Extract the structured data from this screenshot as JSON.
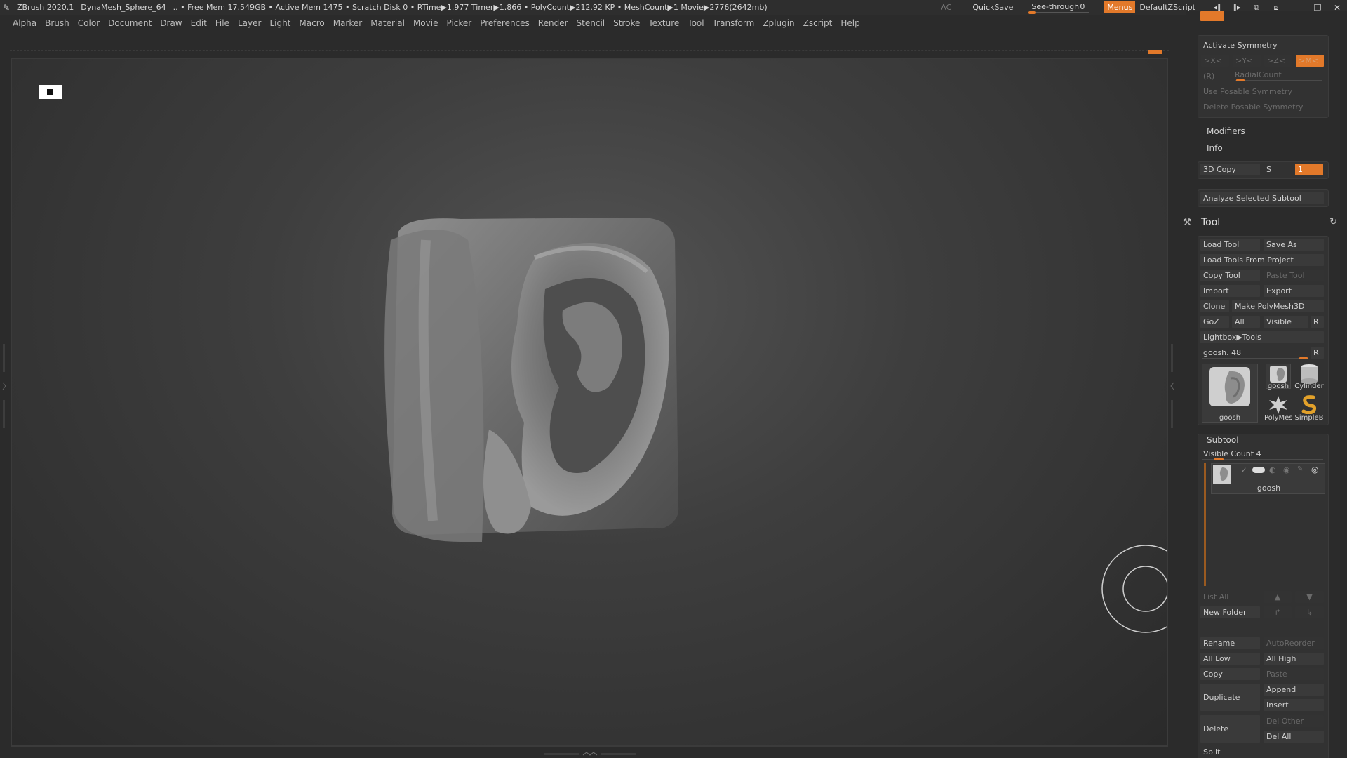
{
  "titlebar": {
    "app": "ZBrush 2020.1",
    "document": "DynaMesh_Sphere_64",
    "stats": ".. • Free Mem 17.549GB • Active Mem 1475 • Scratch Disk 0 • RTime▶1.977 Timer▶1.866 • PolyCount▶212.92 KP • MeshCount▶1 Movie▶2776(2642mb)",
    "ac": "AC",
    "quicksave": "QuickSave",
    "see_through_label": "See-through",
    "see_through_value": "0",
    "see_through_level": 0,
    "menus": "Menus",
    "default_zscript": "DefaultZScript"
  },
  "menubar": [
    "Alpha",
    "Brush",
    "Color",
    "Document",
    "Draw",
    "Edit",
    "File",
    "Layer",
    "Light",
    "Macro",
    "Marker",
    "Material",
    "Movie",
    "Picker",
    "Preferences",
    "Render",
    "Stencil",
    "Stroke",
    "Texture",
    "Tool",
    "Transform",
    "Zplugin",
    "Zscript",
    "Help"
  ],
  "symmetry": {
    "activate": "Activate Symmetry",
    "x": ">X<",
    "y": ">Y<",
    "z": ">Z<",
    "m": ">M<",
    "r": "(R)",
    "radial_count": "RadialCount",
    "use_posable": "Use Posable Symmetry",
    "delete_posable": "Delete Posable Symmetry"
  },
  "modifiers": "Modifiers",
  "info": "Info",
  "copy3d": {
    "label": "3D Copy",
    "s": "S",
    "value": "1"
  },
  "analyze": "Analyze Selected Subtool",
  "tool": {
    "title": "Tool",
    "load_tool": "Load Tool",
    "save_as": "Save As",
    "load_from_project": "Load Tools From Project",
    "copy_tool": "Copy Tool",
    "paste_tool": "Paste Tool",
    "import": "Import",
    "export": "Export",
    "clone": "Clone",
    "make_polymesh": "Make PolyMesh3D",
    "goz": "GoZ",
    "all": "All",
    "visible": "Visible",
    "r": "R",
    "lightbox": "Lightbox▶Tools",
    "current_name": "goosh. 48",
    "current_r": "R",
    "thumbs": {
      "main": "goosh",
      "small1": "goosh",
      "cylinder": "Cylinder",
      "polymesh": "PolyMes",
      "simpleb": "SimpleB"
    }
  },
  "subtool": {
    "title": "Subtool",
    "visible_count": "Visible Count 4",
    "item_name": "goosh",
    "list_all": "List All",
    "new_folder": "New Folder",
    "rename": "Rename",
    "auto_reorder": "AutoReorder",
    "all_low": "All Low",
    "all_high": "All High",
    "copy": "Copy",
    "paste": "Paste",
    "duplicate": "Duplicate",
    "append": "Append",
    "insert": "Insert",
    "delete": "Delete",
    "del_other": "Del Other",
    "del_all": "Del All",
    "split": "Split"
  },
  "colors": {
    "accent": "#e2792a",
    "background": "#2b2b2b",
    "panel": "#323232"
  }
}
